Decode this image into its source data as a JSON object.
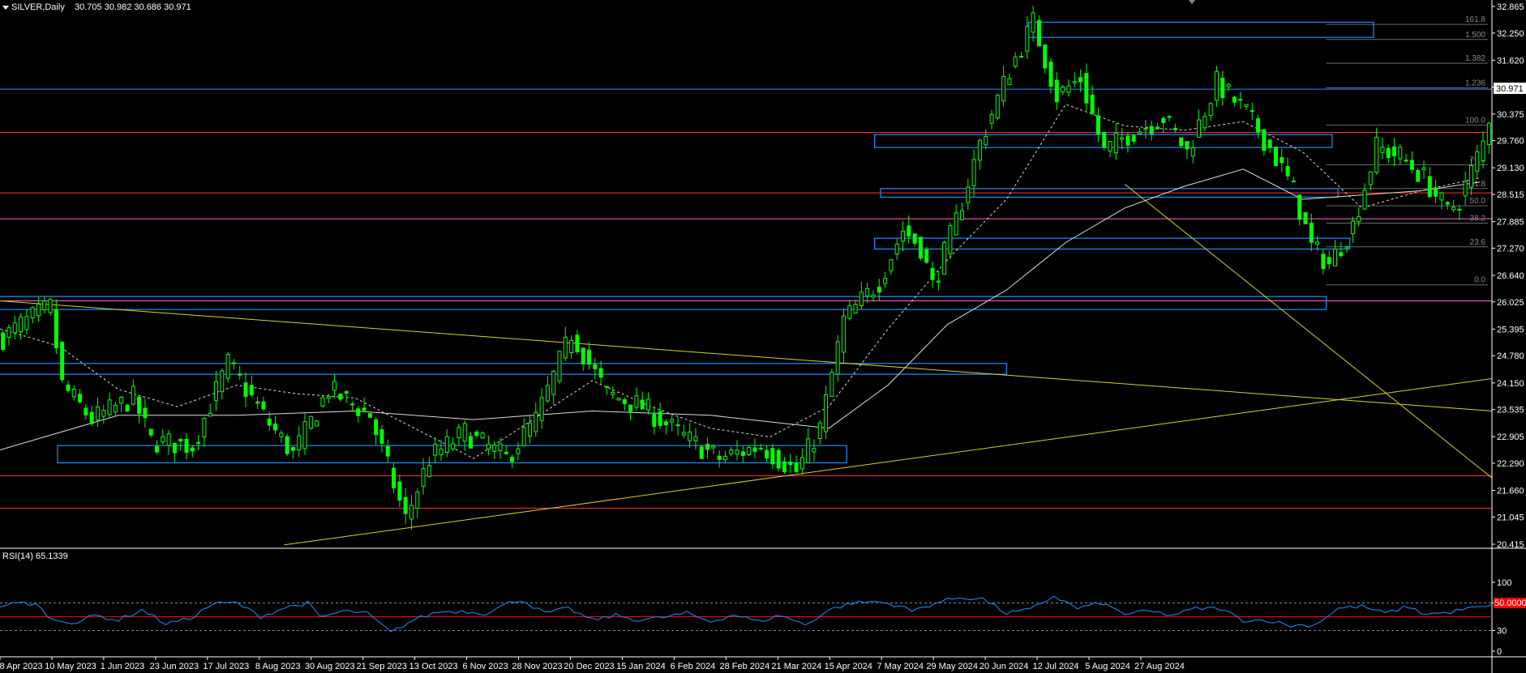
{
  "header": {
    "symbol": "SILVER,Daily",
    "ohlc": "30.705 30.982 30.686 30.971"
  },
  "rsi_header": "RSI(14) 65.1339",
  "colors": {
    "background": "#000000",
    "bull": "#00ff00",
    "bear": "#00ff00",
    "zone": "#1e90ff",
    "support": "#ff3030",
    "trend": "#d8d030",
    "pink": "#ff66cc",
    "rsi": "#1e90ff",
    "rsi_mid": "#ff0000",
    "grid": "#555555",
    "ma": "#dddddd"
  },
  "chart_data": {
    "type": "candlestick",
    "symbol": "SILVER",
    "timeframe": "Daily",
    "x_ticks": [
      "18 Apr 2023",
      "10 May 2023",
      "1 Jun 2023",
      "23 Jun 2023",
      "17 Jul 2023",
      "8 Aug 2023",
      "30 Aug 2023",
      "21 Sep 2023",
      "13 Oct 2023",
      "6 Nov 2023",
      "28 Nov 2023",
      "20 Dec 2023",
      "15 Jan 2024",
      "6 Feb 2024",
      "28 Feb 2024",
      "21 Mar 2024",
      "15 Apr 2024",
      "7 May 2024",
      "29 May 2024",
      "20 Jun 2024",
      "12 Jul 2024",
      "5 Aug 2024",
      "27 Aug 2024"
    ],
    "y_ticks": [
      "32.865",
      "32.250",
      "31.620",
      "31.000",
      "30.375",
      "29.760",
      "29.130",
      "28.515",
      "27.885",
      "27.270",
      "26.640",
      "26.025",
      "25.395",
      "24.780",
      "24.150",
      "23.535",
      "22.905",
      "22.290",
      "21.660",
      "21.045",
      "20.415"
    ],
    "ylim": [
      20.415,
      32.865
    ],
    "last_price": "30.971",
    "price_path": [
      [
        0,
        25.2
      ],
      [
        3,
        25.5
      ],
      [
        8,
        25.9
      ],
      [
        10,
        24.1
      ],
      [
        15,
        23.3
      ],
      [
        22,
        23.8
      ],
      [
        25,
        22.8
      ],
      [
        32,
        22.7
      ],
      [
        38,
        24.6
      ],
      [
        45,
        23.2
      ],
      [
        49,
        22.5
      ],
      [
        55,
        24.0
      ],
      [
        62,
        23.4
      ],
      [
        68,
        21.0
      ],
      [
        72,
        22.4
      ],
      [
        78,
        23.0
      ],
      [
        85,
        22.4
      ],
      [
        90,
        23.3
      ],
      [
        96,
        25.3
      ],
      [
        102,
        23.9
      ],
      [
        108,
        23.6
      ],
      [
        115,
        22.9
      ],
      [
        121,
        22.4
      ],
      [
        128,
        22.7
      ],
      [
        134,
        22.1
      ],
      [
        138,
        23.1
      ],
      [
        142,
        25.6
      ],
      [
        148,
        26.5
      ],
      [
        152,
        27.7
      ],
      [
        155,
        27.3
      ],
      [
        157,
        26.4
      ],
      [
        161,
        27.9
      ],
      [
        165,
        29.7
      ],
      [
        170,
        31.4
      ],
      [
        174,
        32.5
      ],
      [
        178,
        30.8
      ],
      [
        182,
        31.2
      ],
      [
        186,
        29.5
      ],
      [
        190,
        29.9
      ],
      [
        196,
        30.3
      ],
      [
        200,
        29.5
      ],
      [
        205,
        31.1
      ],
      [
        210,
        30.4
      ],
      [
        214,
        29.6
      ],
      [
        218,
        28.6
      ],
      [
        221,
        27.3
      ],
      [
        224,
        26.9
      ],
      [
        228,
        27.8
      ],
      [
        232,
        29.6
      ],
      [
        236,
        29.4
      ],
      [
        240,
        28.9
      ],
      [
        244,
        28.1
      ],
      [
        246,
        28.4
      ],
      [
        250,
        29.7
      ],
      [
        252,
        30.95
      ]
    ],
    "ma_fast_path": [
      [
        0,
        25.4
      ],
      [
        10,
        25.0
      ],
      [
        20,
        24.0
      ],
      [
        30,
        23.6
      ],
      [
        40,
        24.1
      ],
      [
        50,
        23.9
      ],
      [
        60,
        23.8
      ],
      [
        70,
        23.1
      ],
      [
        80,
        22.4
      ],
      [
        90,
        23.3
      ],
      [
        100,
        24.2
      ],
      [
        110,
        23.6
      ],
      [
        120,
        23.1
      ],
      [
        130,
        22.9
      ],
      [
        140,
        23.6
      ],
      [
        150,
        25.4
      ],
      [
        160,
        27.0
      ],
      [
        170,
        28.4
      ],
      [
        180,
        30.6
      ],
      [
        190,
        30.1
      ],
      [
        200,
        30.0
      ],
      [
        210,
        30.2
      ],
      [
        220,
        29.5
      ],
      [
        230,
        28.2
      ],
      [
        240,
        28.6
      ],
      [
        250,
        28.9
      ]
    ],
    "ma_slow_path": [
      [
        0,
        22.6
      ],
      [
        20,
        23.4
      ],
      [
        40,
        23.4
      ],
      [
        60,
        23.5
      ],
      [
        80,
        23.3
      ],
      [
        100,
        23.5
      ],
      [
        120,
        23.4
      ],
      [
        140,
        23.1
      ],
      [
        150,
        24.1
      ],
      [
        160,
        25.5
      ],
      [
        170,
        26.3
      ],
      [
        180,
        27.4
      ],
      [
        190,
        28.2
      ],
      [
        200,
        28.7
      ],
      [
        210,
        29.1
      ],
      [
        220,
        28.4
      ],
      [
        230,
        28.5
      ],
      [
        240,
        28.6
      ],
      [
        250,
        28.8
      ]
    ],
    "horizontal_levels": [
      {
        "price": 30.95,
        "color": "zone"
      },
      {
        "price": 29.95,
        "color": "support"
      },
      {
        "price": 28.55,
        "color": "support"
      },
      {
        "price": 27.95,
        "color": "pink"
      },
      {
        "price": 26.05,
        "color": "pink"
      },
      {
        "price": 22.0,
        "color": "support"
      },
      {
        "price": 21.25,
        "color": "support"
      }
    ],
    "zones": [
      {
        "from": 32.15,
        "to": 32.5,
        "start": 174,
        "end": 232
      },
      {
        "from": 29.6,
        "to": 29.9,
        "start": 148,
        "end": 225
      },
      {
        "from": 28.45,
        "to": 28.65,
        "start": 149,
        "end": 226
      },
      {
        "from": 27.25,
        "to": 27.5,
        "start": 148,
        "end": 228
      },
      {
        "from": 25.85,
        "to": 26.15,
        "start": 0,
        "end": 224
      },
      {
        "from": 24.35,
        "to": 24.6,
        "start": 0,
        "end": 170
      },
      {
        "from": 22.3,
        "to": 22.7,
        "start": 10,
        "end": 143
      }
    ],
    "trendlines": [
      {
        "from": [
          0,
          26.05
        ],
        "to": [
          252,
          23.5
        ]
      },
      {
        "from": [
          48,
          20.4
        ],
        "to": [
          252,
          24.25
        ]
      },
      {
        "from": [
          190,
          28.75
        ],
        "to": [
          252,
          21.95
        ]
      }
    ],
    "fibonacci": {
      "high": 32.9,
      "low": 26.4,
      "anchor_start": 224,
      "levels": [
        {
          "label": "161.8",
          "price": 32.45
        },
        {
          "label": "1.500",
          "price": 32.1
        },
        {
          "label": "1.382",
          "price": 31.55
        },
        {
          "label": "1.236",
          "price": 30.98
        },
        {
          "label": "100.0",
          "price": 30.12
        },
        {
          "label": "76.4",
          "price": 29.2
        },
        {
          "label": "61.8",
          "price": 28.65
        },
        {
          "label": "50.0",
          "price": 28.25
        },
        {
          "label": "38.2",
          "price": 27.85
        },
        {
          "label": "23.6",
          "price": 27.3
        },
        {
          "label": "0.0",
          "price": 26.42
        }
      ]
    },
    "rsi": {
      "period": 14,
      "value": "65.1339",
      "y_ticks": [
        "100",
        "70",
        "50.0000",
        "30",
        "0"
      ],
      "levels": [
        70,
        50,
        30
      ],
      "path": [
        [
          0,
          66
        ],
        [
          4,
          70
        ],
        [
          6,
          68
        ],
        [
          9,
          45
        ],
        [
          13,
          42
        ],
        [
          16,
          52
        ],
        [
          20,
          45
        ],
        [
          24,
          60
        ],
        [
          28,
          40
        ],
        [
          32,
          47
        ],
        [
          36,
          69
        ],
        [
          40,
          70
        ],
        [
          44,
          50
        ],
        [
          48,
          63
        ],
        [
          52,
          70
        ],
        [
          54,
          49
        ],
        [
          58,
          58
        ],
        [
          62,
          55
        ],
        [
          66,
          27
        ],
        [
          70,
          46
        ],
        [
          74,
          57
        ],
        [
          78,
          58
        ],
        [
          82,
          55
        ],
        [
          86,
          70
        ],
        [
          88,
          75
        ],
        [
          92,
          55
        ],
        [
          96,
          62
        ],
        [
          100,
          45
        ],
        [
          104,
          52
        ],
        [
          108,
          45
        ],
        [
          112,
          49
        ],
        [
          116,
          55
        ],
        [
          120,
          43
        ],
        [
          124,
          53
        ],
        [
          128,
          43
        ],
        [
          132,
          52
        ],
        [
          136,
          38
        ],
        [
          140,
          60
        ],
        [
          144,
          70
        ],
        [
          148,
          72
        ],
        [
          152,
          66
        ],
        [
          154,
          58
        ],
        [
          158,
          70
        ],
        [
          162,
          78
        ],
        [
          166,
          76
        ],
        [
          170,
          55
        ],
        [
          174,
          60
        ],
        [
          178,
          80
        ],
        [
          182,
          62
        ],
        [
          186,
          70
        ],
        [
          190,
          54
        ],
        [
          194,
          58
        ],
        [
          198,
          52
        ],
        [
          202,
          62
        ],
        [
          206,
          62
        ],
        [
          210,
          45
        ],
        [
          214,
          45
        ],
        [
          218,
          37
        ],
        [
          222,
          38
        ],
        [
          226,
          62
        ],
        [
          230,
          65
        ],
        [
          234,
          55
        ],
        [
          238,
          65
        ],
        [
          240,
          55
        ],
        [
          244,
          55
        ],
        [
          248,
          62
        ],
        [
          252,
          65
        ]
      ]
    }
  }
}
